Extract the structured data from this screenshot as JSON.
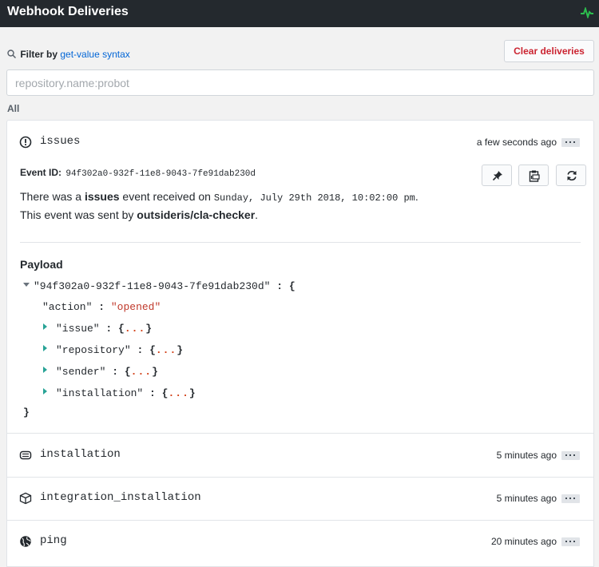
{
  "header": {
    "title": "Webhook Deliveries",
    "pulse_icon": "pulse-icon"
  },
  "filter": {
    "label": "Filter by",
    "link": "get-value syntax",
    "placeholder": "repository.name:probot",
    "value": ""
  },
  "clear_button": "Clear deliveries",
  "all_label": "All",
  "expanded": {
    "event": "issues",
    "time": "a few seconds ago",
    "event_id_label": "Event ID:",
    "event_id": "94f302a0-932f-11e8-9043-7fe91dab230d",
    "line1_prefix": "There was a",
    "line1_event": "issues",
    "line1_mid": "event received on",
    "line1_date": "Sunday, July 29th 2018, 10:02:00 pm",
    "line1_end": ".",
    "line2_prefix": "This event was sent by",
    "line2_sender": "outsideris/cla-checker",
    "line2_end": ".",
    "payload_title": "Payload",
    "payload": {
      "root_key": "\"94f302a0-932f-11e8-9043-7fe91dab230d\"",
      "action_key": "\"action\"",
      "action_val": "\"opened\"",
      "collapsed_keys": [
        "\"issue\"",
        "\"repository\"",
        "\"sender\"",
        "\"installation\""
      ],
      "ellipsis": "...",
      "colon": ":",
      "open_brace": "{",
      "close_brace": "}"
    }
  },
  "rows": [
    {
      "event": "installation",
      "time": "5 minutes ago",
      "icon": "installation-icon"
    },
    {
      "event": "integration_installation",
      "time": "5 minutes ago",
      "icon": "package-icon"
    },
    {
      "event": "ping",
      "time": "20 minutes ago",
      "icon": "globe-icon"
    }
  ],
  "actions": [
    "pin-icon",
    "clipboard-icon",
    "redeliver-icon"
  ],
  "colors": {
    "header_bg": "#24292e",
    "link": "#0366d6",
    "danger": "#cb2431",
    "pulse": "#2cbe4e",
    "json_value": "#c0392b",
    "caret": "#28a396"
  }
}
